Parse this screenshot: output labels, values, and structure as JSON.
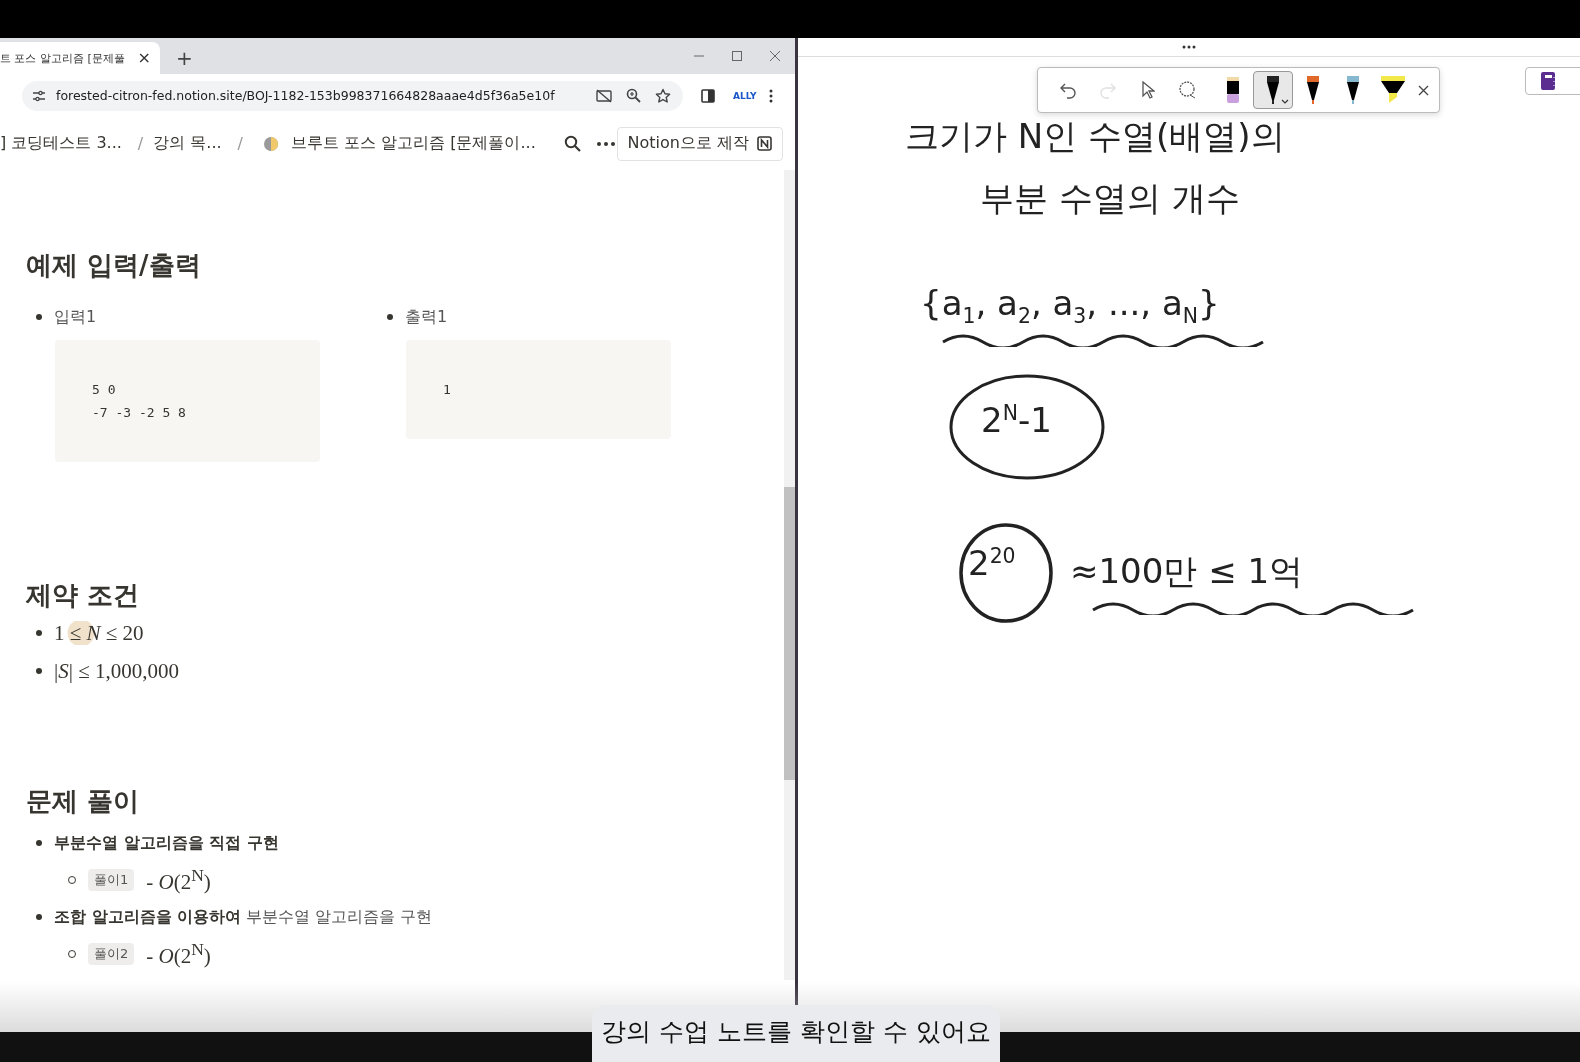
{
  "browser": {
    "tab_title": "트 포스 알고리즘 [문제풀",
    "tab_close": "×",
    "new_tab": "+",
    "url": "forested-citron-fed.notion.site/BOJ-1182-153b998371664828aaae4d5f36a5e10f",
    "extension_label": "ALLY",
    "breadcrumbs": [
      {
        "label": "] 코딩테스트 3..."
      },
      {
        "label": "강의 목...",
        "separator": "/"
      },
      {
        "label": "브루트 포스 알고리즘 [문제풀이...",
        "separator": "/"
      }
    ],
    "made_with": "Notion으로 제작"
  },
  "page": {
    "sections": [
      {
        "kind": "examples",
        "heading": "예제 입력/출력",
        "examples": [
          {
            "label": "입력1",
            "code": "5 0\n-7 -3 -2 5 8"
          },
          {
            "label": "출력1",
            "code": "1"
          }
        ]
      },
      {
        "kind": "constraints",
        "heading": "제약 조건",
        "items": [
          "1 ≤ *N* ≤ 20",
          "|*S*|  ≤  1,000,000"
        ]
      },
      {
        "kind": "solutions",
        "heading": "문제 풀이",
        "items": [
          {
            "text": "**부분수열 알고리즘을 직접 구현**",
            "children": [
              {
                "tag": "풀이1",
                "complexity": "- *O*(2$^{N}$)"
              }
            ]
          },
          {
            "text": "**조합 알고리즘을 이용하여** 부분수열 알고리즘을 구현",
            "children": [
              {
                "tag": "풀이2",
                "complexity": "- *O*(2$^{N}$)"
              }
            ]
          }
        ]
      }
    ]
  },
  "ink": {
    "toolbar": [
      {
        "kind": "undo",
        "disabled": false,
        "selected": false
      },
      {
        "kind": "redo",
        "disabled": true,
        "selected": false
      },
      {
        "kind": "select",
        "disabled": false,
        "selected": false
      },
      {
        "kind": "lasso",
        "disabled": false,
        "selected": false
      },
      {
        "kind": "eraser",
        "color": "#c9a0dc",
        "disabled": false,
        "selected": false
      },
      {
        "kind": "pen",
        "color": "#222222",
        "disabled": false,
        "selected": true
      },
      {
        "kind": "pen",
        "color": "#e0692a",
        "disabled": false,
        "selected": false
      },
      {
        "kind": "pen",
        "color": "#86b8cf",
        "disabled": false,
        "selected": false
      },
      {
        "kind": "highlighter",
        "color": "#f3e84a",
        "disabled": false,
        "selected": false
      }
    ],
    "notes": [
      {
        "kind": "line",
        "text": "크기가 N인 수열(배열)의"
      },
      {
        "kind": "line",
        "text": "부분 수열의 개수"
      },
      {
        "kind": "underlined",
        "text": "{a$_{1}$, a$_{2}$, a$_{3}$, ..., a$_{N}$}"
      },
      {
        "kind": "ellipse",
        "text": "2$^{N}$-1"
      },
      {
        "kind": "circle",
        "text": "2$^{20}$"
      },
      {
        "kind": "underlined",
        "text": "≈100만  ≤ 1억"
      }
    ]
  },
  "caption": "강의 수업 노트를 확인할 수 있어요"
}
